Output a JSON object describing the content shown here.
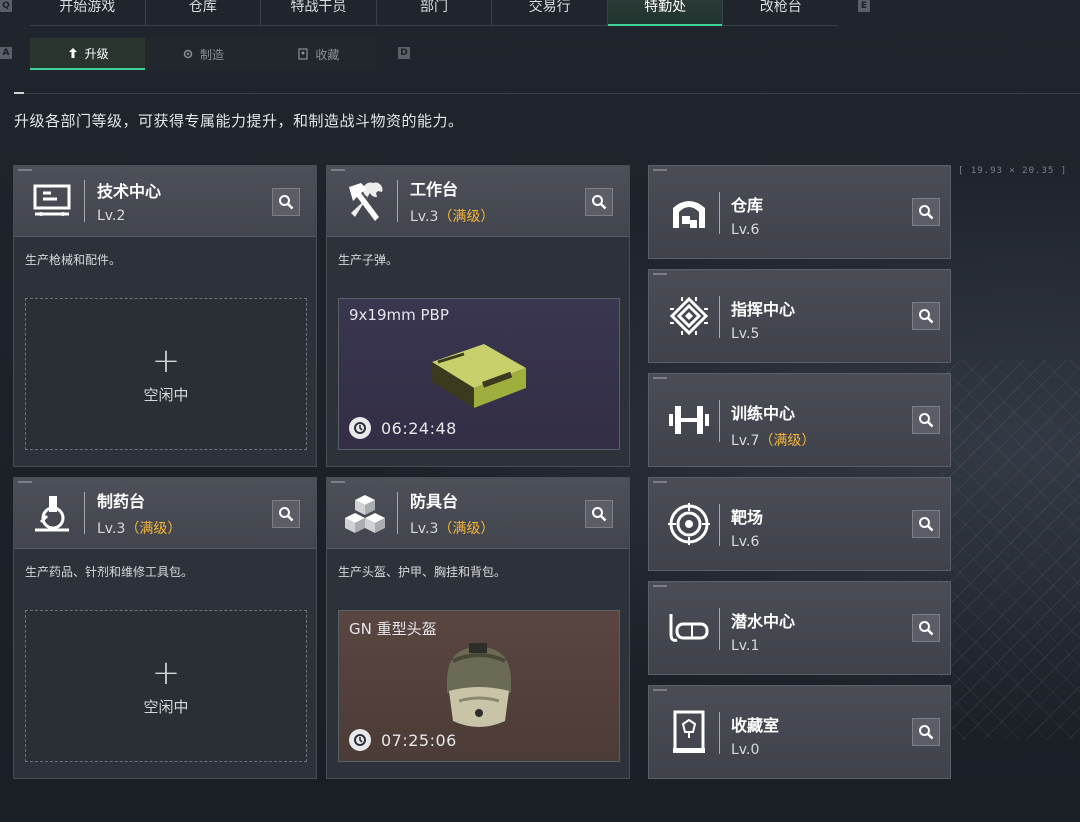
{
  "nav": {
    "tabs": [
      "开始游戏",
      "仓库",
      "特战干员",
      "部门",
      "交易行",
      "特勤处",
      "改枪台"
    ],
    "active_tab": "特勤处",
    "left_key": "Q",
    "right_key": "E"
  },
  "subnav": {
    "tabs": [
      "升级",
      "制造",
      "收藏"
    ],
    "active": "升级",
    "left_key": "A",
    "right_key": "D"
  },
  "description": "升级各部门等级，可获得专属能力提升，和制造战斗物资的能力。",
  "coordinate": "[ 19.93 × 20.35 ]",
  "cards": [
    {
      "title": "技术中心",
      "level": "Lv.2",
      "max": "",
      "desc": "生产枪械和配件。",
      "state": "空闲中",
      "icon": "monitor-icon"
    },
    {
      "title": "工作台",
      "level": "Lv.3",
      "max": "（满级）",
      "desc": "生产子弹。",
      "product": "9x19mm PBP",
      "timer": "06:24:48",
      "icon": "hammer-wrench-icon"
    },
    {
      "title": "制药台",
      "level": "Lv.3",
      "max": "（满级）",
      "desc": "生产药品、针剂和维修工具包。",
      "state": "空闲中",
      "icon": "microscope-icon"
    },
    {
      "title": "防具台",
      "level": "Lv.3",
      "max": "（满级）",
      "desc": "生产头盔、护甲、胸挂和背包。",
      "product": "GN 重型头盔",
      "timer": "07:25:06",
      "icon": "cubes-icon"
    }
  ],
  "side": [
    {
      "title": "仓库",
      "level": "Lv.6",
      "max": "",
      "icon": "warehouse-icon"
    },
    {
      "title": "指挥中心",
      "level": "Lv.5",
      "max": "",
      "icon": "chip-icon"
    },
    {
      "title": "训练中心",
      "level": "Lv.7",
      "max": "（满级）",
      "icon": "dumbbell-icon"
    },
    {
      "title": "靶场",
      "level": "Lv.6",
      "max": "",
      "icon": "target-icon"
    },
    {
      "title": "潜水中心",
      "level": "Lv.1",
      "max": "",
      "icon": "dive-mask-icon"
    },
    {
      "title": "收藏室",
      "level": "Lv.0",
      "max": "",
      "icon": "display-case-icon"
    }
  ],
  "colors": {
    "accent": "#3fd39a",
    "max_level": "#f2b43a"
  }
}
